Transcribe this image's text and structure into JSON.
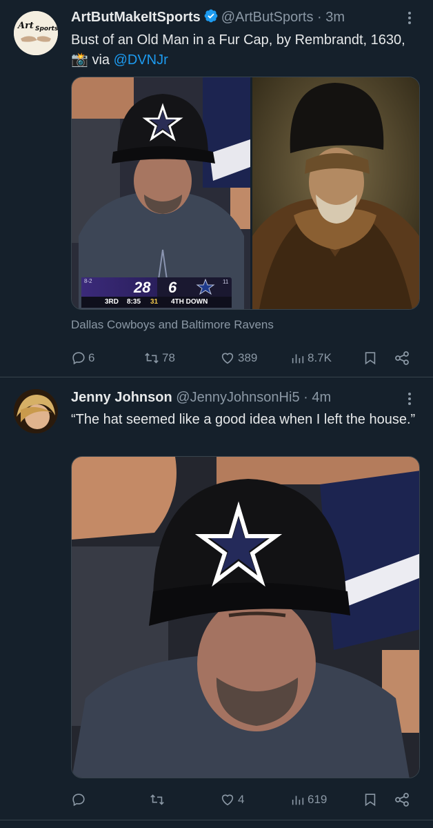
{
  "tweets": [
    {
      "display_name": "ArtButMakeItSports",
      "handle": "@ArtButSports",
      "time": "· 3m",
      "avatar_text_1": "Art",
      "avatar_text_2": "Sports",
      "text_before": "Bust of an Old Man in a Fur Cap, by Rembrandt, 1630, ",
      "camera_emoji": "📸",
      "text_via": " via ",
      "mention": "@DVNJr",
      "caption": "Dallas Cowboys and Baltimore Ravens",
      "scoreboard": {
        "record": "8-2",
        "home_score": "28",
        "away_score": "6",
        "quarter": "3RD",
        "clock": "8:35",
        "yard": "31",
        "down": "4TH DOWN",
        "away_record": "11"
      },
      "stats": {
        "replies": "6",
        "reposts": "78",
        "likes": "389",
        "views": "8.7K"
      }
    },
    {
      "display_name": "Jenny Johnson",
      "handle": "@JennyJohnsonHi5",
      "time": "· 4m",
      "text": "“The hat seemed like a good idea when I left the house.”",
      "stats": {
        "replies": "",
        "reposts": "",
        "likes": "4",
        "views": "619"
      }
    }
  ],
  "colors": {
    "background": "#15202b",
    "text": "#e7e9ea",
    "muted": "#8b98a5",
    "link": "#1d9bf0",
    "divider": "#38444d"
  },
  "icons": [
    "verified-badge-icon",
    "more-icon",
    "reply-icon",
    "repost-icon",
    "like-icon",
    "views-icon",
    "bookmark-icon",
    "share-icon"
  ]
}
